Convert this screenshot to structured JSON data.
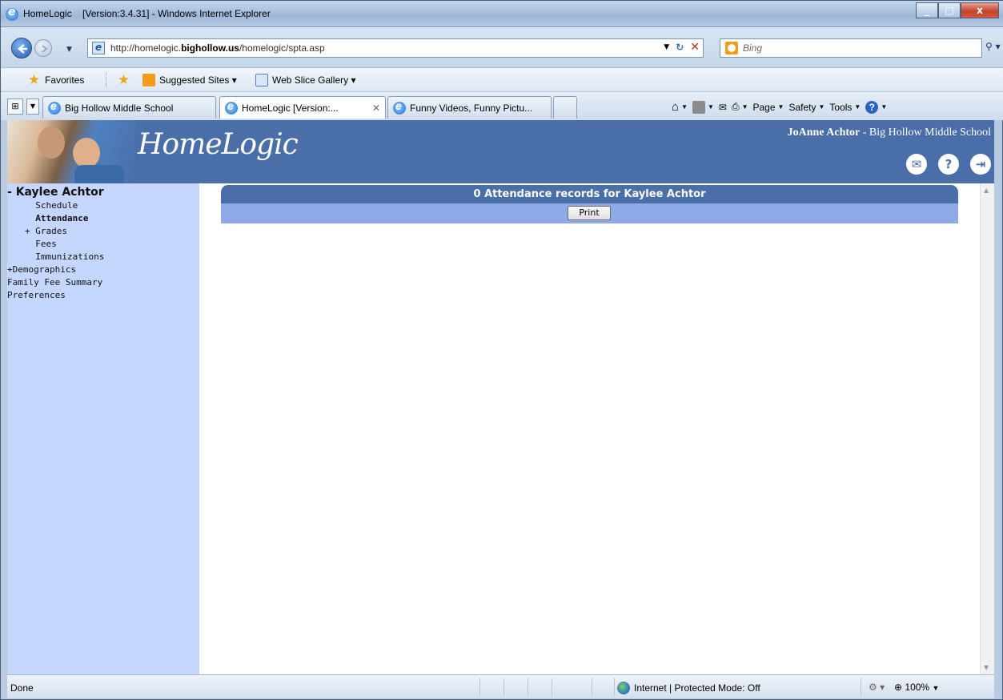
{
  "window": {
    "title": "HomeLogic    [Version:3.4.31] - Windows Internet Explorer"
  },
  "address": {
    "url_prefix": "http://homelogic.",
    "url_domain": "bighollow.us",
    "url_suffix": "/homelogic/spta.asp",
    "search_placeholder": "Bing"
  },
  "favorites": {
    "favorites_label": "Favorites",
    "suggested_sites": "Suggested Sites ▾",
    "web_slice_gallery": "Web Slice Gallery ▾"
  },
  "tabs": [
    {
      "label": "Big Hollow Middle School"
    },
    {
      "label": "HomeLogic    [Version:..."
    },
    {
      "label": "Funny Videos, Funny Pictu..."
    }
  ],
  "command_bar": {
    "page": "Page",
    "safety": "Safety",
    "tools": "Tools"
  },
  "header": {
    "logo_text": "HomeLogic",
    "user_name": "JoAnne Achtor",
    "user_school": " - Big Hollow Middle School"
  },
  "sidebar": {
    "student_name": "Kaylee Achtor",
    "items": [
      "  Schedule",
      "  Attendance",
      "+ Grades",
      "  Fees",
      "  Immunizations",
      "+Demographics",
      "Family Fee Summary",
      "Preferences"
    ]
  },
  "content": {
    "heading": "0 Attendance records for Kaylee Achtor",
    "print_label": "Print"
  },
  "status": {
    "left_text": "Done",
    "zone": "Internet | Protected Mode: Off",
    "zoom": "100%"
  },
  "colors": {
    "header_blue": "#4a6ea8",
    "sidebar_bg": "#c5d6ff",
    "subbar_bg": "#8fa8e6"
  }
}
